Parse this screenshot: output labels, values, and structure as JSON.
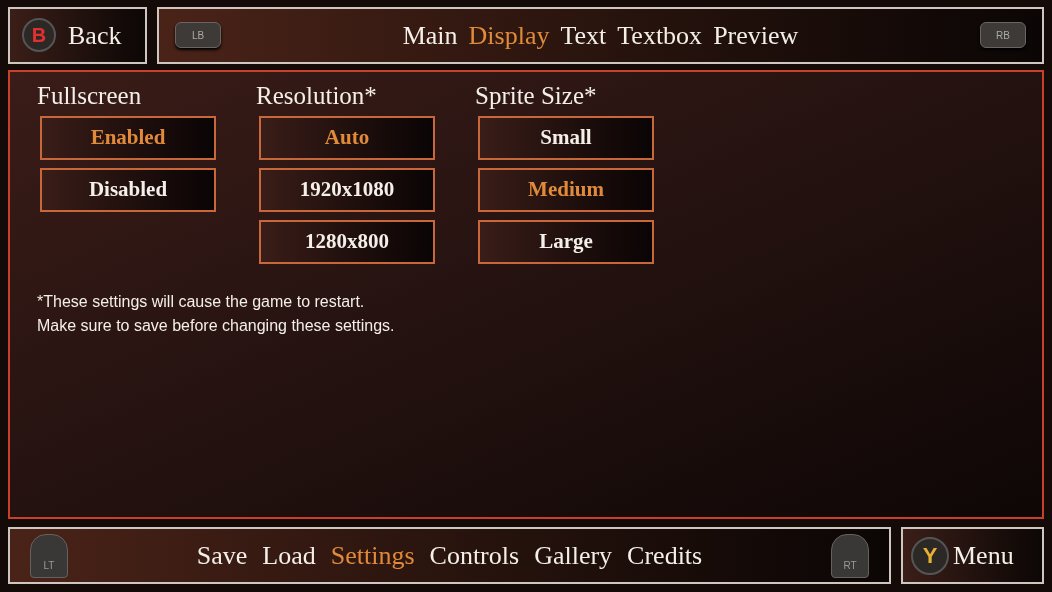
{
  "back_button": {
    "key": "B",
    "label": "Back"
  },
  "top_tabs": {
    "left_key": "LB",
    "right_key": "RB",
    "items": [
      {
        "label": "Main",
        "selected": false
      },
      {
        "label": "Display",
        "selected": true
      },
      {
        "label": "Text",
        "selected": false
      },
      {
        "label": "Textbox",
        "selected": false
      },
      {
        "label": "Preview",
        "selected": false
      }
    ]
  },
  "settings": [
    {
      "title": "Fullscreen",
      "options": [
        {
          "label": "Enabled",
          "selected": true
        },
        {
          "label": "Disabled",
          "selected": false
        }
      ]
    },
    {
      "title": "Resolution*",
      "options": [
        {
          "label": "Auto",
          "selected": true
        },
        {
          "label": "1920x1080",
          "selected": false
        },
        {
          "label": "1280x800",
          "selected": false
        }
      ]
    },
    {
      "title": "Sprite Size*",
      "options": [
        {
          "label": "Small",
          "selected": false
        },
        {
          "label": "Medium",
          "selected": true
        },
        {
          "label": "Large",
          "selected": false
        }
      ]
    }
  ],
  "note": [
    "*These settings will cause the game to restart.",
    "Make sure to save before changing these settings."
  ],
  "bottom_tabs": {
    "left_key": "LT",
    "right_key": "RT",
    "items": [
      {
        "label": "Save",
        "selected": false
      },
      {
        "label": "Load",
        "selected": false
      },
      {
        "label": "Settings",
        "selected": true
      },
      {
        "label": "Controls",
        "selected": false
      },
      {
        "label": "Gallery",
        "selected": false
      },
      {
        "label": "Credits",
        "selected": false
      }
    ]
  },
  "menu_button": {
    "key": "Y",
    "label": "Menu"
  }
}
